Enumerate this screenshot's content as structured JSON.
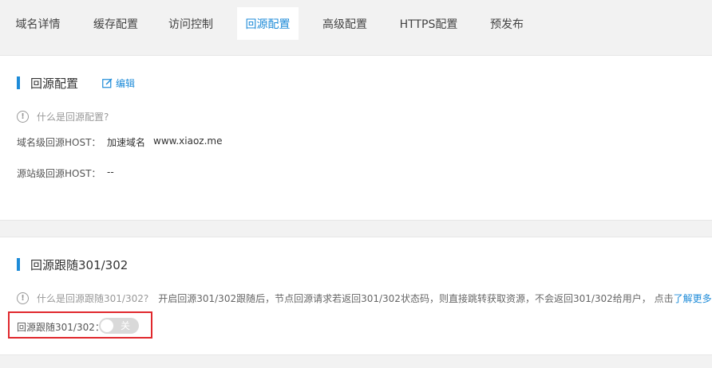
{
  "tabs": [
    {
      "label": "域名详情"
    },
    {
      "label": "缓存配置"
    },
    {
      "label": "访问控制"
    },
    {
      "label": "回源配置"
    },
    {
      "label": "高级配置"
    },
    {
      "label": "HTTPS配置"
    },
    {
      "label": "预发布"
    }
  ],
  "active_tab": "回源配置",
  "origin": {
    "title": "回源配置",
    "edit_label": "编辑",
    "help_text": "什么是回源配置?",
    "domain_host_label": "域名级回源HOST：",
    "domain_host_type": "加速域名",
    "domain_host_value": "www.xiaoz.me",
    "site_host_label": "源站级回源HOST：",
    "site_host_value": "--"
  },
  "follow": {
    "title": "回源跟随301/302",
    "help_text": "什么是回源跟随301/302?",
    "description": "开启回源301/302跟随后，节点回源请求若返回301/302状态码，则直接跳转获取资源，不会返回301/302给用户， 点击",
    "more_link": "了解更多",
    "toggle_label": "回源跟随301/302：",
    "toggle_state": "关"
  },
  "colors": {
    "accent": "#1d8bd8",
    "highlight": "#e0282d"
  }
}
